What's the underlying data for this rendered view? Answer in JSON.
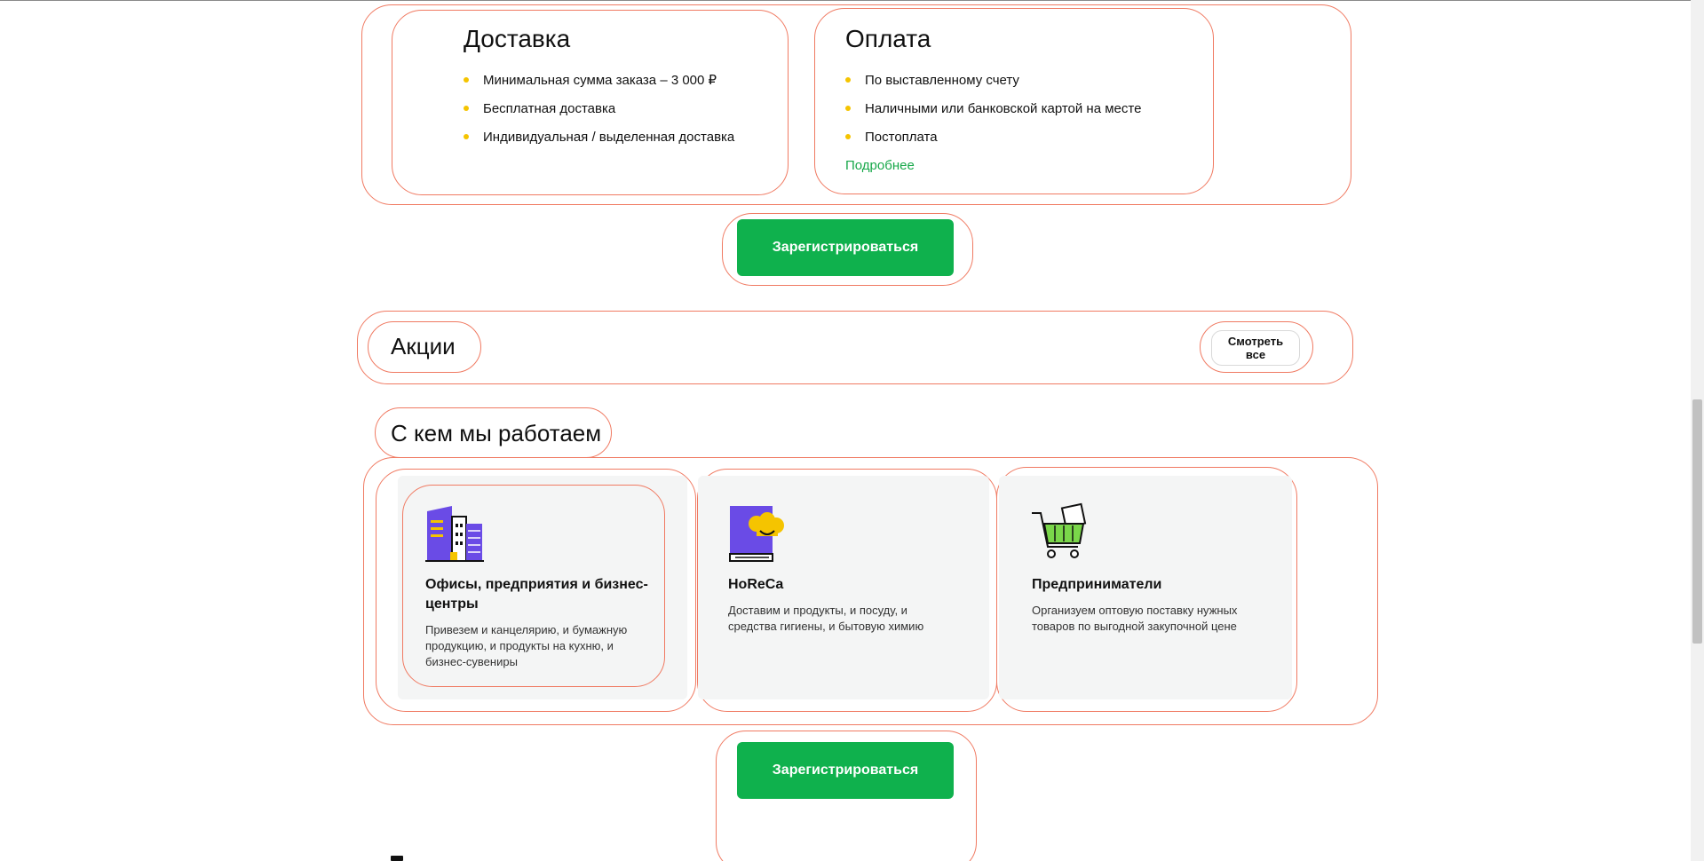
{
  "delivery": {
    "title": "Доставка",
    "items": [
      "Минимальная сумма заказа – 3 000 ₽",
      "Бесплатная доставка",
      "Индивидуальная / выделенная доставка"
    ]
  },
  "payment": {
    "title": "Оплата",
    "items": [
      "По выставленному счету",
      "Наличными или банковской картой на месте",
      "Постоплата"
    ],
    "more_link": "Подробнее"
  },
  "register_button_label": "Зарегистрироваться",
  "promotions": {
    "title": "Акции",
    "view_all_label": "Смотреть все"
  },
  "partners": {
    "title": "С кем мы работаем",
    "tiles": [
      {
        "title": "Офисы, предприятия и бизнес-центры",
        "description": "Привезем и канцелярию, и бумажную продукцию, и продукты на кухню, и бизнес-сувениры",
        "icon": "office-building-icon"
      },
      {
        "title": "HoReCa",
        "description": "Доставим и продукты, и посуду, и средства гигиены, и бытовую химию",
        "icon": "chef-hat-book-icon"
      },
      {
        "title": "Предприниматели",
        "description": "Организуем оптовую поставку нужных товаров по выгодной закупочной цене",
        "icon": "shopping-cart-icon"
      }
    ]
  },
  "colors": {
    "accent_green": "#0fb14d",
    "link_green": "#18a84a",
    "bullet_yellow": "#f5c400",
    "outline": "#f07a62"
  }
}
